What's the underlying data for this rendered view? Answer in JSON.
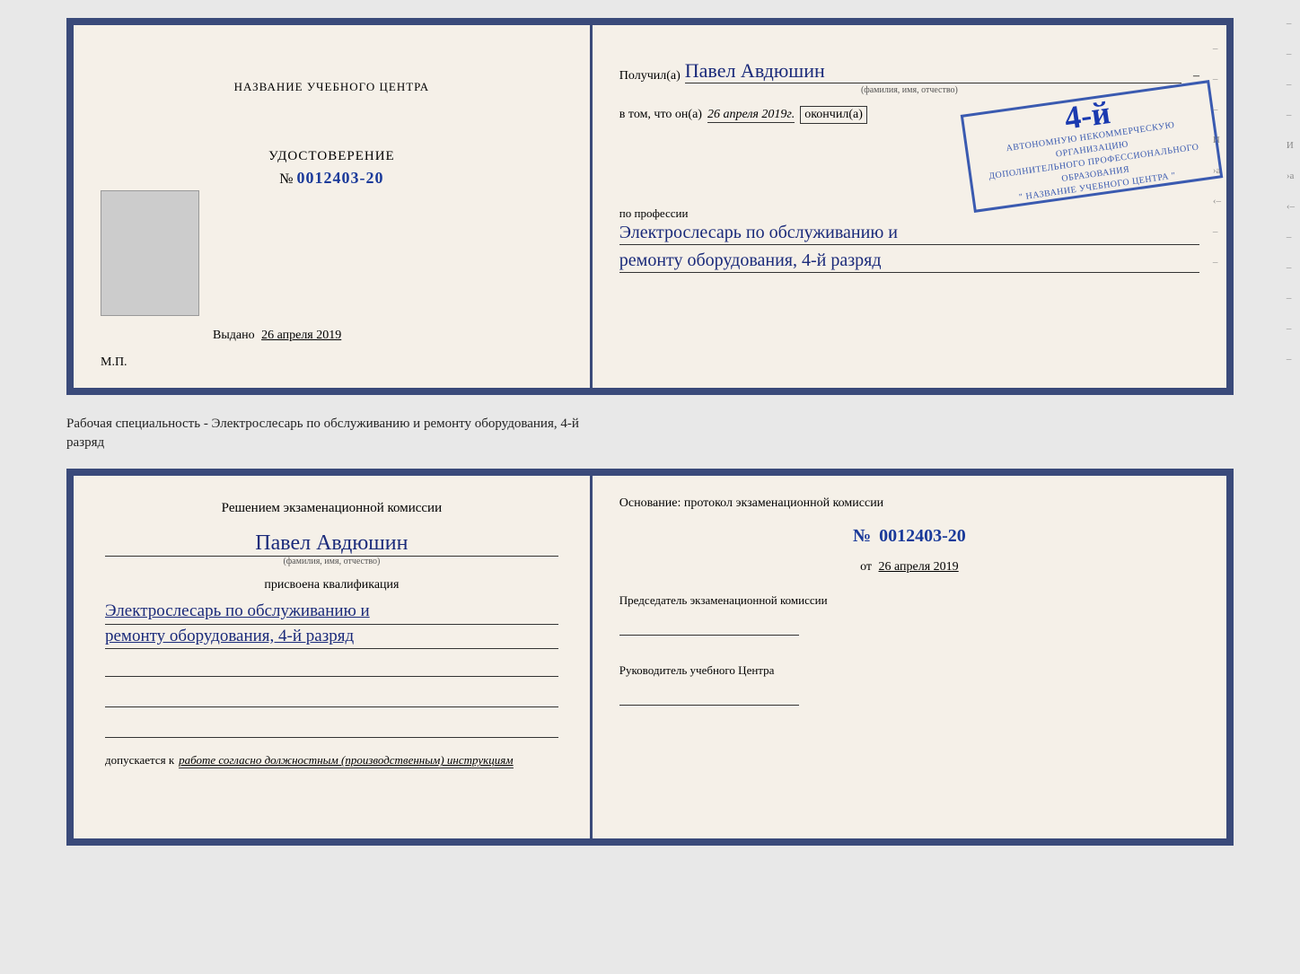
{
  "top_doc": {
    "left": {
      "center_title": "НАЗВАНИЕ УЧЕБНОГО ЦЕНТРА",
      "cert_label": "УДОСТОВЕРЕНИЕ",
      "cert_number_prefix": "№",
      "cert_number": "0012403-20",
      "issued_label": "Выдано",
      "issued_date": "26 апреля 2019",
      "mp_label": "М.П."
    },
    "right": {
      "recipient_prefix": "Получил(а)",
      "recipient_name": "Павел Авдюшин",
      "recipient_sublabel": "(фамилия, имя, отчество)",
      "vtom_prefix": "в том, что он(а)",
      "vtom_date": "26 апреля 2019г.",
      "okoncil_label": "окончил(а)",
      "stamp_rank": "4-й",
      "stamp_line1": "АВТОНОМНУЮ НЕКОММЕРЧЕСКУЮ ОРГАНИЗАЦИЮ",
      "stamp_line2": "ДОПОЛНИТЕЛЬНОГО ПРОФЕССИОНАЛЬНОГО ОБРАЗОВАНИЯ",
      "stamp_name": "\" НАЗВАНИЕ УЧЕБНОГО ЦЕНТРА \"",
      "profession_prefix": "по профессии",
      "profession_line1": "Электрослесарь по обслуживанию и",
      "profession_line2": "ремонту оборудования, 4-й разряд"
    }
  },
  "separator": {
    "text": "Рабочая специальность - Электрослесарь по обслуживанию и ремонту оборудования, 4-й",
    "text2": "разряд"
  },
  "bottom_doc": {
    "left": {
      "commission_title": "Решением экзаменационной комиссии",
      "person_name": "Павел Авдюшин",
      "person_sublabel": "(фамилия, имя, отчество)",
      "assigned_label": "присвоена квалификация",
      "qualification_line1": "Электрослесарь по обслуживанию и",
      "qualification_line2": "ремонту оборудования, 4-й разряд",
      "dopusk_prefix": "допускается к",
      "dopusk_value": "работе согласно должностным (производственным) инструкциям"
    },
    "right": {
      "osnование_text": "Основание: протокол экзаменационной комиссии",
      "protocol_prefix": "№",
      "protocol_number": "0012403-20",
      "ot_prefix": "от",
      "ot_date": "26 апреля 2019",
      "chairman_label": "Председатель экзаменационной комиссии",
      "head_label": "Руководитель учебного Центра"
    }
  },
  "edge_marks": {
    "marks": [
      "–",
      "–",
      "–",
      "–",
      "И",
      "›а",
      "‹–",
      "–",
      "–",
      "–",
      "–",
      "–",
      "–",
      "–"
    ]
  }
}
